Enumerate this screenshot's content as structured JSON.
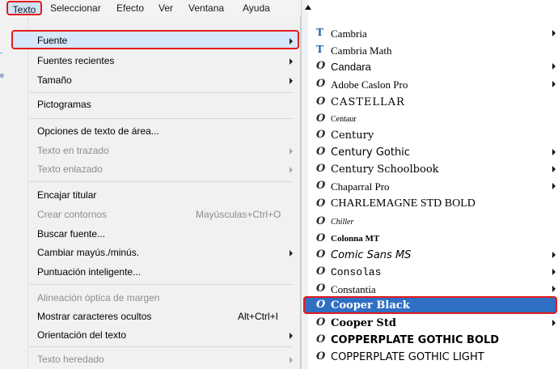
{
  "menubar": {
    "items": [
      "Texto",
      "Seleccionar",
      "Efecto",
      "Ver",
      "Ventana",
      "Ayuda"
    ]
  },
  "text_menu": {
    "items": [
      {
        "label": "Fuente",
        "submenu": true,
        "disabled": false,
        "highlighted": true
      },
      {
        "label": "Fuentes recientes",
        "submenu": true,
        "disabled": false
      },
      {
        "label": "Tamaño",
        "submenu": true,
        "disabled": false
      },
      {
        "label": "Pictogramas",
        "submenu": false,
        "disabled": false
      },
      {
        "label": "Opciones de texto de área...",
        "submenu": false,
        "disabled": false
      },
      {
        "label": "Texto en trazado",
        "submenu": true,
        "disabled": true
      },
      {
        "label": "Texto enlazado",
        "submenu": true,
        "disabled": true
      },
      {
        "label": "Encajar titular",
        "submenu": false,
        "disabled": false
      },
      {
        "label": "Crear contornos",
        "shortcut": "Mayúsculas+Ctrl+O",
        "disabled": true
      },
      {
        "label": "Buscar fuente...",
        "submenu": false,
        "disabled": false
      },
      {
        "label": "Cambiar mayús./minús.",
        "submenu": true,
        "disabled": false
      },
      {
        "label": "Puntuación inteligente...",
        "submenu": false,
        "disabled": false
      },
      {
        "label": "Alineación óptica de margen",
        "submenu": false,
        "disabled": true
      },
      {
        "label": "Mostrar caracteres ocultos",
        "shortcut": "Alt+Ctrl+I",
        "disabled": false
      },
      {
        "label": "Orientación del texto",
        "submenu": true,
        "disabled": false
      },
      {
        "label": "Texto heredado",
        "submenu": true,
        "disabled": true
      }
    ]
  },
  "font_menu": {
    "items": [
      {
        "name": "Cambria",
        "icon": "truetype-icon",
        "submenu": true
      },
      {
        "name": "Cambria Math",
        "icon": "truetype-icon",
        "submenu": false
      },
      {
        "name": "Candara",
        "icon": "opentype-icon",
        "submenu": true
      },
      {
        "name": "Adobe Caslon Pro",
        "icon": "opentype-icon",
        "submenu": true
      },
      {
        "name": "CASTELLAR",
        "icon": "opentype-icon",
        "submenu": false
      },
      {
        "name": "Centaur",
        "icon": "opentype-icon",
        "submenu": false
      },
      {
        "name": "Century",
        "icon": "opentype-icon",
        "submenu": false
      },
      {
        "name": "Century Gothic",
        "icon": "opentype-icon",
        "submenu": true
      },
      {
        "name": "Century Schoolbook",
        "icon": "opentype-icon",
        "submenu": true
      },
      {
        "name": "Chaparral Pro",
        "icon": "opentype-icon",
        "submenu": true
      },
      {
        "name": "CHARLEMAGNE STD BOLD",
        "icon": "opentype-icon",
        "submenu": false
      },
      {
        "name": "Chiller",
        "icon": "opentype-icon",
        "submenu": false
      },
      {
        "name": "Colonna MT",
        "icon": "opentype-icon",
        "submenu": false
      },
      {
        "name": "Comic Sans MS",
        "icon": "opentype-icon",
        "submenu": true
      },
      {
        "name": "Consolas",
        "icon": "opentype-icon",
        "submenu": true
      },
      {
        "name": "Constantia",
        "icon": "opentype-icon",
        "submenu": true
      },
      {
        "name": "Cooper Black",
        "icon": "opentype-icon",
        "submenu": false,
        "highlighted": true
      },
      {
        "name": "Cooper Std",
        "icon": "opentype-icon",
        "submenu": true
      },
      {
        "name": "COPPERPLATE GOTHIC BOLD",
        "icon": "opentype-icon",
        "submenu": false
      },
      {
        "name": "COPPERPLATE GOTHIC LIGHT",
        "icon": "opentype-icon",
        "submenu": false
      }
    ]
  },
  "colors": {
    "accent": "#2f6fc4",
    "highlight_border": "#e31b1b"
  }
}
